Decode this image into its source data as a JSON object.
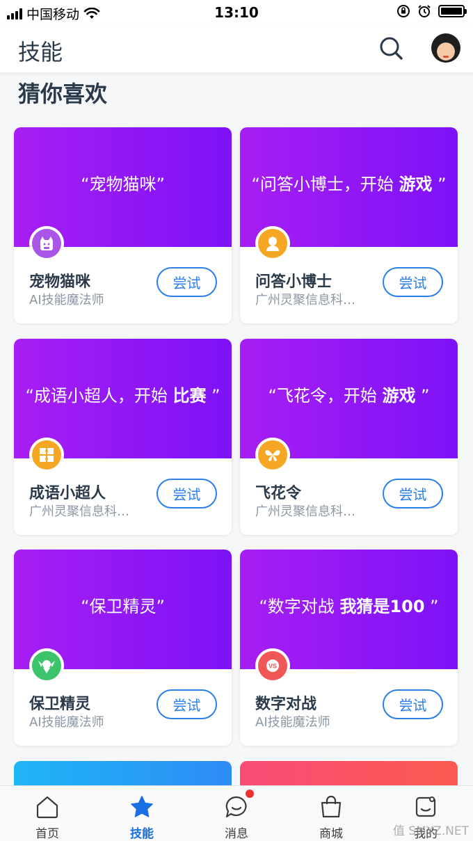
{
  "status_bar": {
    "carrier": "中国移动",
    "time": "13:10"
  },
  "header": {
    "title": "技能"
  },
  "section": {
    "title": "猜你喜欢"
  },
  "skills": [
    {
      "quote": "“宠物猫咪”",
      "quote_bold": "",
      "quote_end": "",
      "name": "宠物猫咪",
      "developer": "AI技能魔法师",
      "button": "尝试",
      "icon": "cat-icon",
      "icon_color": "#a855e8"
    },
    {
      "quote": "“问答小博士，开始 ",
      "quote_bold": "游戏",
      "quote_end": " ”",
      "name": "问答小博士",
      "developer": "广州灵聚信息科…",
      "button": "尝试",
      "icon": "doctor-icon",
      "icon_color": "#f5a623"
    },
    {
      "quote": "“成语小超人，开始 ",
      "quote_bold": "比赛",
      "quote_end": " ”",
      "name": "成语小超人",
      "developer": "广州灵聚信息科…",
      "button": "尝试",
      "icon": "puzzle-icon",
      "icon_color": "#f5a623"
    },
    {
      "quote": "“飞花令，开始 ",
      "quote_bold": "游戏",
      "quote_end": " ”",
      "name": "飞花令",
      "developer": "广州灵聚信息科…",
      "button": "尝试",
      "icon": "butterfly-icon",
      "icon_color": "#f5a623"
    },
    {
      "quote": "“保卫精灵”",
      "quote_bold": "",
      "quote_end": "",
      "name": "保卫精灵",
      "developer": "AI技能魔法师",
      "button": "尝试",
      "icon": "sprite-icon",
      "icon_color": "#3cc46a"
    },
    {
      "quote": "“数字对战 ",
      "quote_bold": "我猜是100",
      "quote_end": " ”",
      "name": "数字对战",
      "developer": "AI技能魔法师",
      "button": "尝试",
      "icon": "versus-icon",
      "icon_color": "#f25757"
    }
  ],
  "tabs": [
    {
      "label": "首页",
      "icon": "home-icon",
      "active": false
    },
    {
      "label": "技能",
      "icon": "star-icon",
      "active": true
    },
    {
      "label": "消息",
      "icon": "message-icon",
      "active": false,
      "badge": true
    },
    {
      "label": "商城",
      "icon": "shopping-bag-icon",
      "active": false
    },
    {
      "label": "我的",
      "icon": "profile-icon",
      "active": false
    }
  ],
  "watermark": "值 SMYZ.NET",
  "colors": {
    "banner_start": "#a71ef3",
    "banner_end": "#7d12f7",
    "accent_blue": "#2a7fe8",
    "tab_active": "#1a6fe3",
    "badge_red": "#f0302e"
  }
}
